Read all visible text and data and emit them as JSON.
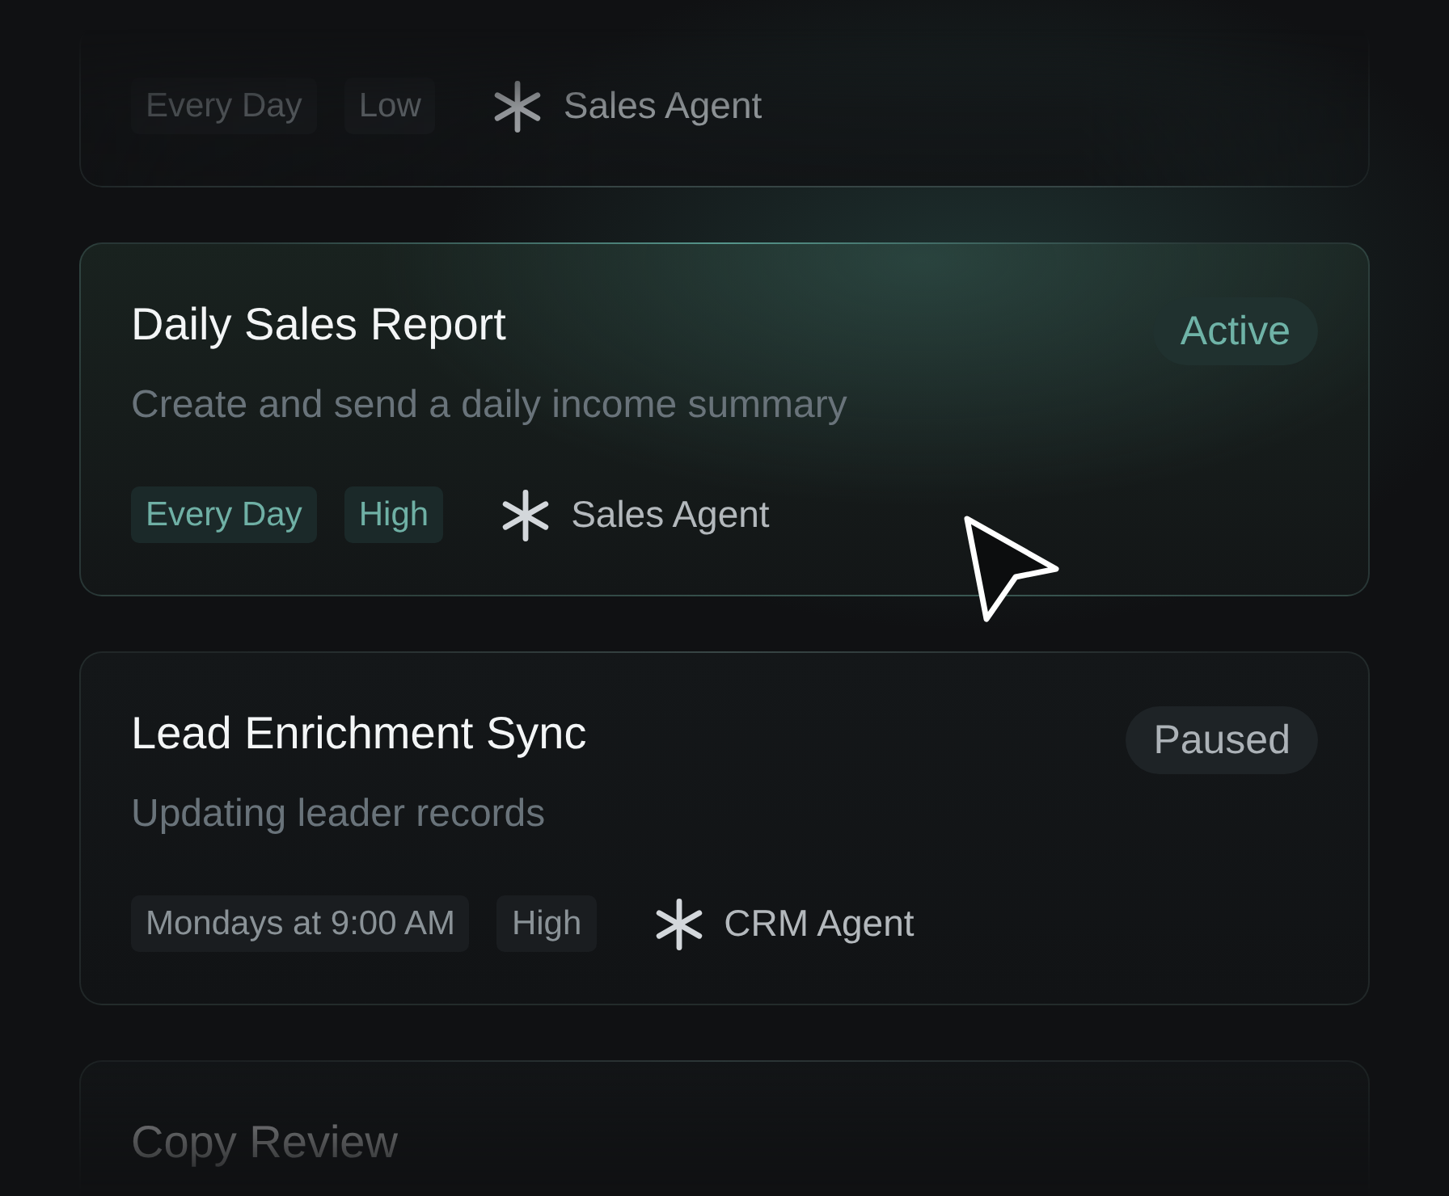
{
  "tasks": [
    {
      "highlighted": false,
      "tags": [
        {
          "label": "Every Day"
        },
        {
          "label": "Low"
        }
      ],
      "agent": "Sales Agent"
    },
    {
      "highlighted": true,
      "title": "Daily Sales Report",
      "status": {
        "kind": "active",
        "label": "Active"
      },
      "description": "Create and send a daily income summary",
      "tags": [
        {
          "label": "Every Day"
        },
        {
          "label": "High"
        }
      ],
      "agent": "Sales Agent"
    },
    {
      "highlighted": false,
      "title": "Lead Enrichment Sync",
      "status": {
        "kind": "paused",
        "label": "Paused"
      },
      "description": "Updating leader records",
      "tags": [
        {
          "label": "Mondays at 9:00 AM"
        },
        {
          "label": "High"
        }
      ],
      "agent": "CRM Agent"
    },
    {
      "highlighted": false,
      "title": "Copy Review"
    }
  ]
}
